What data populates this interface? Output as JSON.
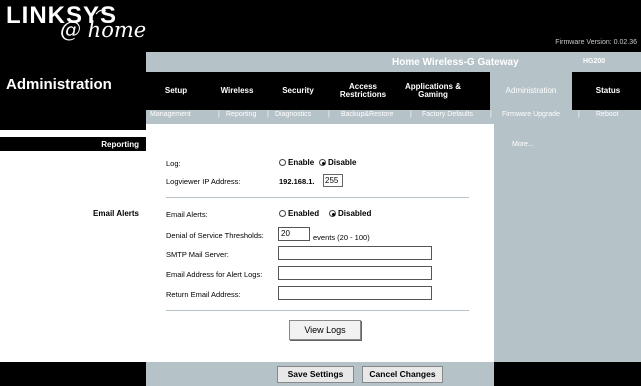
{
  "brand": {
    "logo_text": "LINKSYS",
    "logo_script": "@ home"
  },
  "firmware": "Firmware Version: 0.02.36",
  "product": {
    "name": "Home Wireless-G Gateway",
    "model": "HG200"
  },
  "page_title": "Administration",
  "tabs": [
    {
      "label": "Setup"
    },
    {
      "label": "Wireless"
    },
    {
      "label": "Security"
    },
    {
      "label": "Access Restrictions"
    },
    {
      "label": "Applications & Gaming"
    },
    {
      "label": "Administration"
    },
    {
      "label": "Status"
    }
  ],
  "subtabs": [
    "Management",
    "Reporting",
    "Diagnostics",
    "Backup&Restore",
    "Factory Defaults",
    "Firmware Upgrade",
    "Reboot"
  ],
  "sections": {
    "reporting": "Reporting",
    "email_alerts": "Email Alerts"
  },
  "form": {
    "log_label": "Log:",
    "log_enable": "Enable",
    "log_disable": "Disable",
    "logviewer_label": "Logviewer IP Address:",
    "logviewer_base": "192.168.1.",
    "logviewer_last": "255",
    "email_alerts_label": "Email Alerts:",
    "email_enabled": "Enabled",
    "email_disabled": "Disabled",
    "dos_label": "Denial of Service Thresholds:",
    "dos_value": "20",
    "dos_suffix": "events (20 - 100)",
    "smtp_label": "SMTP Mail Server:",
    "smtp_value": "",
    "alert_email_label": "Email Address for Alert Logs:",
    "alert_email_value": "",
    "return_email_label": "Return Email Address:",
    "return_email_value": "",
    "view_logs": "View Logs"
  },
  "right_panel": {
    "more": "More..."
  },
  "footer": {
    "save": "Save Settings",
    "cancel": "Cancel Changes"
  }
}
